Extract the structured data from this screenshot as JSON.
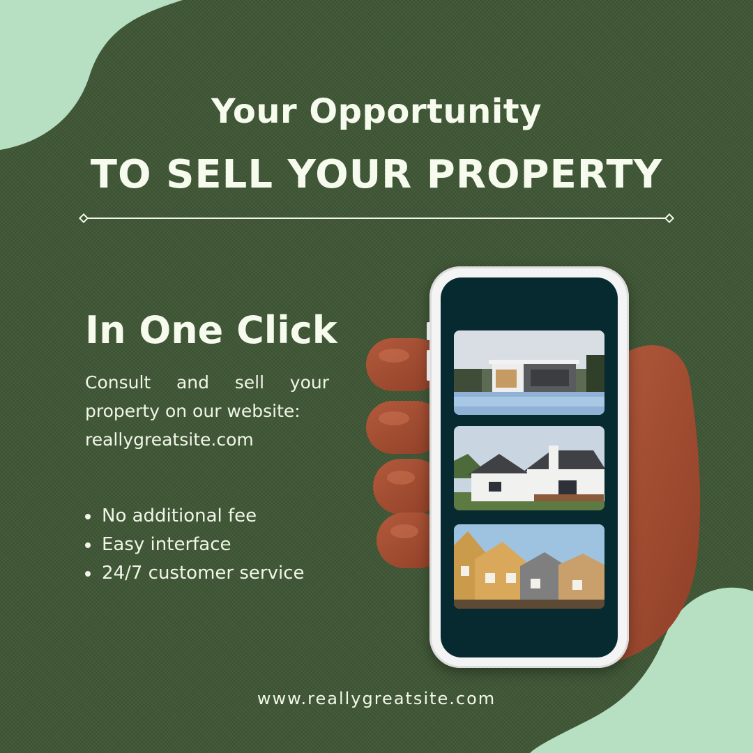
{
  "header": {
    "title_line1": "Your Opportunity",
    "title_line2": "TO SELL YOUR PROPERTY"
  },
  "promo": {
    "headline": "In One Click",
    "description": "Consult and sell your property on our website:",
    "website": "reallygreatsite.com"
  },
  "features": [
    "No additional fee",
    "Easy interface",
    "24/7 customer service"
  ],
  "footer": {
    "url": "www.reallygreatsite.com"
  },
  "phone": {
    "listings": [
      {
        "icon": "modern-house-with-pool-image"
      },
      {
        "icon": "white-house-image"
      },
      {
        "icon": "townhouses-image"
      }
    ]
  },
  "colors": {
    "background": "#3e5634",
    "accent_blob": "#b7dfc2",
    "text": "#f6fbee",
    "phone_screen": "#062a30",
    "hand": "#a44d33"
  }
}
